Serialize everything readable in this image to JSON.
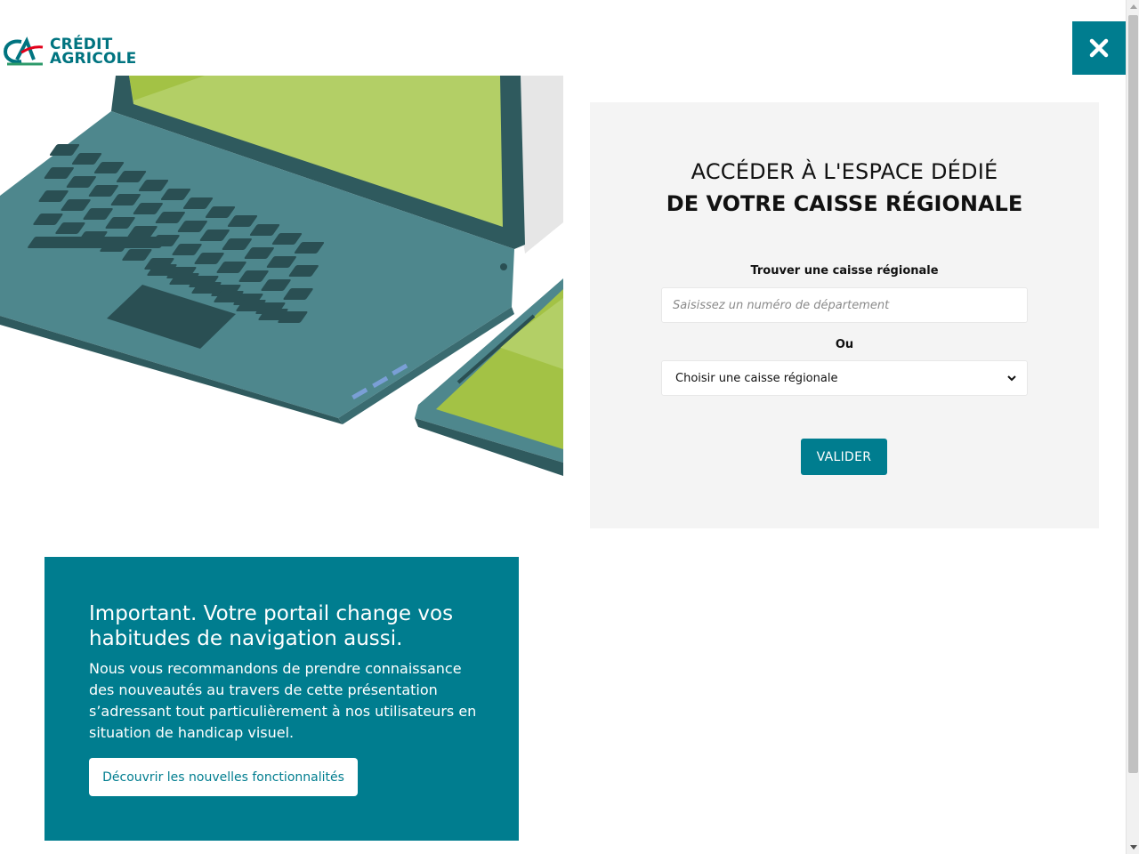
{
  "header": {
    "logo_line1": "CRÉDIT",
    "logo_line2": "AGRICOLE",
    "close_icon": "close-icon"
  },
  "panel": {
    "title_line1": "ACCÉDER À L'ESPACE DÉDIÉ",
    "title_line2": "DE VOTRE CAISSE RÉGIONALE",
    "find_label": "Trouver une caisse régionale",
    "dept_input_value": "",
    "dept_input_placeholder": "Saisissez un numéro de département",
    "or_label": "Ou",
    "select_value": "Choisir une caisse régionale",
    "validate_label": "VALIDER"
  },
  "info": {
    "title": "Important. Votre portail change vos habitudes de navigation aussi.",
    "text": "Nous vous recommandons de prendre connaissance des nouveautés au travers de cette présentation s’adressant tout particulièrement à nos utilisateurs en situation de handicap visuel.",
    "button_label": "Découvrir les nouvelles fonctionnalités"
  },
  "colors": {
    "brand_teal": "#007d8f",
    "panel_bg": "#f4f4f4",
    "logo_green": "#2d9a6a",
    "logo_red": "#e2001a"
  }
}
